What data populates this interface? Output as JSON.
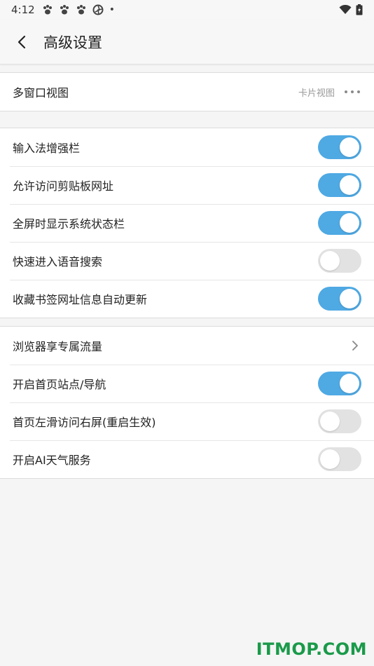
{
  "status_bar": {
    "time": "4:12",
    "notifications": [
      "paw-icon",
      "paw-icon",
      "paw-icon",
      "aperture-icon"
    ],
    "dot": "•"
  },
  "header": {
    "title": "高级设置",
    "back_icon": "chevron-left-icon"
  },
  "groups": {
    "view": {
      "multi_window_label": "多窗口视图",
      "multi_window_value": "卡片视图"
    },
    "input": {
      "items": [
        {
          "label": "输入法增强栏",
          "on": true
        },
        {
          "label": "允许访问剪贴板网址",
          "on": true
        },
        {
          "label": "全屏时显示系统状态栏",
          "on": true
        },
        {
          "label": "快速进入语音搜索",
          "on": false
        },
        {
          "label": "收藏书签网址信息自动更新",
          "on": true
        }
      ]
    },
    "home": {
      "traffic_label": "浏览器享专属流量",
      "items": [
        {
          "label": "开启首页站点/导航",
          "on": true
        },
        {
          "label": "首页左滑访问右屏(重启生效)",
          "on": false
        },
        {
          "label": "开启AI天气服务",
          "on": false
        }
      ]
    }
  },
  "watermark": "ITMOP.COM",
  "colors": {
    "toggle_on": "#4fa9e3",
    "toggle_off": "#e2e2e2",
    "watermark": "#1a9a4a"
  }
}
